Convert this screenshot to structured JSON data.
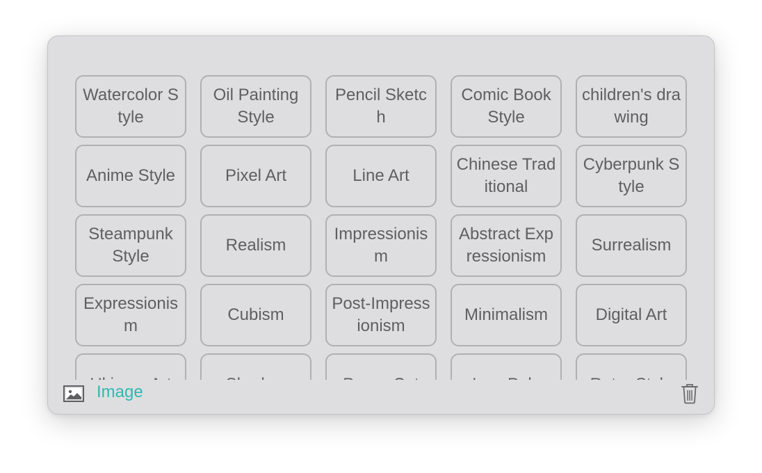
{
  "styles_panel": {
    "style_options": [
      "Watercolor Style",
      "Oil Painting Style",
      "Pencil Sketch",
      "Comic Book Style",
      "children's drawing",
      "Anime Style",
      "Pixel Art",
      "Line Art",
      "Chinese Traditional",
      "Cyberpunk Style",
      "Steampunk Style",
      "Realism",
      "Impressionism",
      "Abstract Expressionism",
      "Surrealism",
      "Expressionism",
      "Cubism",
      "Post-Impressionism",
      "Minimalism",
      "Digital Art",
      "Ukiyo-e Art",
      "Shadow",
      "Paper-Cut",
      "Low Poly",
      "Retro Style"
    ]
  },
  "footer": {
    "image_icon": "image-icon",
    "image_label": "Image",
    "delete_icon": "trash-icon",
    "accent_color": "#2fb8b1"
  }
}
